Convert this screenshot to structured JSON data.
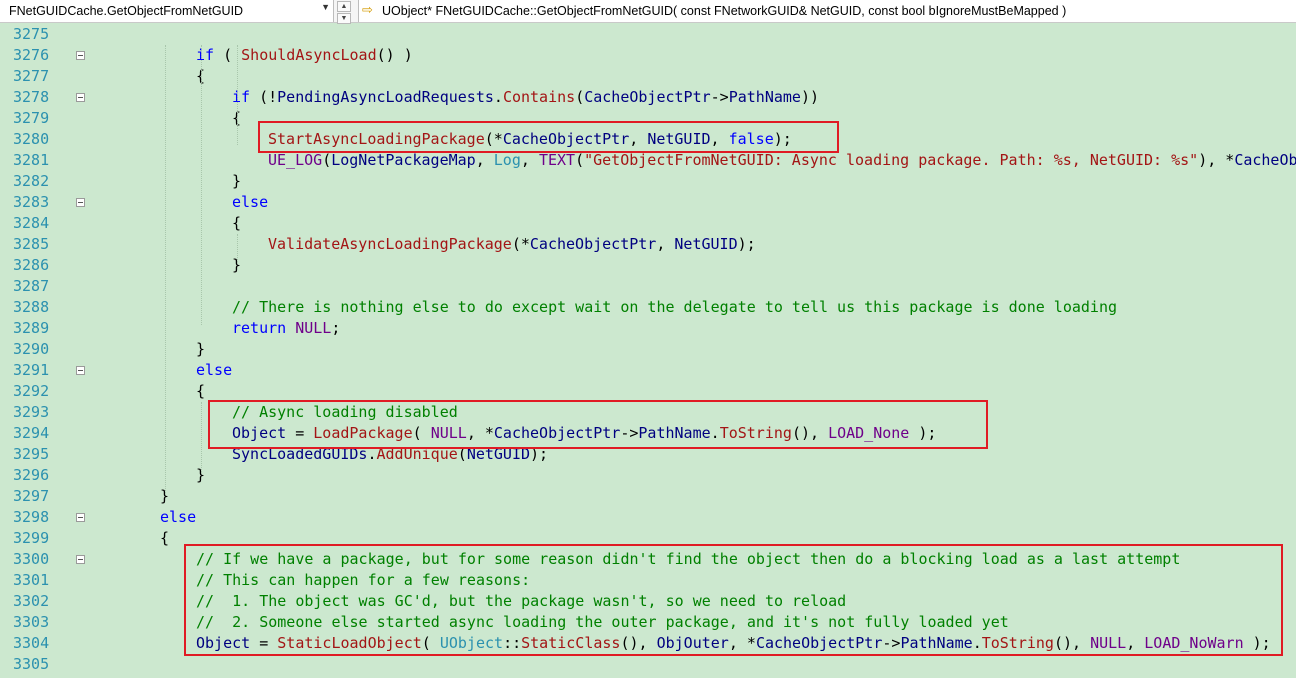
{
  "toolbar": {
    "scope_dropdown": "FNetGUIDCache.GetObjectFromNetGUID",
    "dropdown_arrow": "▼",
    "nav_up": "▲",
    "nav_down": "▼",
    "member_icon": "⇨",
    "member_signature": "UObject* FNetGUIDCache::GetObjectFromNetGUID( const FNetworkGUID& NetGUID, const bool bIgnoreMustBeMapped )"
  },
  "colors": {
    "background": "#cce8cf",
    "line_number": "#2b91af",
    "keyword": "#0000ff",
    "function": "#a31515",
    "type": "#2b91af",
    "comment": "#008000",
    "variable": "#000080",
    "macro": "#6f008a",
    "highlight_box": "#e01b24"
  },
  "lines": [
    {
      "n": "3275",
      "fold": false,
      "indent": 0,
      "tokens": []
    },
    {
      "n": "3276",
      "fold": true,
      "indent": 5,
      "tokens": [
        [
          "k",
          "if"
        ],
        [
          "p",
          " ( "
        ],
        [
          "f",
          "ShouldAsyncLoad"
        ],
        [
          "p",
          "() )"
        ]
      ]
    },
    {
      "n": "3277",
      "fold": false,
      "indent": 5,
      "tokens": [
        [
          "p",
          "{"
        ]
      ]
    },
    {
      "n": "3278",
      "fold": true,
      "indent": 6,
      "tokens": [
        [
          "k",
          "if"
        ],
        [
          "p",
          " (!"
        ],
        [
          "v",
          "PendingAsyncLoadRequests"
        ],
        [
          "p",
          "."
        ],
        [
          "f",
          "Contains"
        ],
        [
          "p",
          "("
        ],
        [
          "v",
          "CacheObjectPtr"
        ],
        [
          "p",
          "->"
        ],
        [
          "v",
          "PathName"
        ],
        [
          "p",
          "))"
        ]
      ]
    },
    {
      "n": "3279",
      "fold": false,
      "indent": 6,
      "tokens": [
        [
          "p",
          "{"
        ]
      ]
    },
    {
      "n": "3280",
      "fold": false,
      "indent": 7,
      "tokens": [
        [
          "f",
          "StartAsyncLoadingPackage"
        ],
        [
          "p",
          "(*"
        ],
        [
          "v",
          "CacheObjectPtr"
        ],
        [
          "p",
          ", "
        ],
        [
          "v",
          "NetGUID"
        ],
        [
          "p",
          ", "
        ],
        [
          "k",
          "false"
        ],
        [
          "p",
          ");"
        ]
      ]
    },
    {
      "n": "3281",
      "fold": false,
      "indent": 7,
      "tokens": [
        [
          "m",
          "UE_LOG"
        ],
        [
          "p",
          "("
        ],
        [
          "v",
          "LogNetPackageMap"
        ],
        [
          "p",
          ", "
        ],
        [
          "t",
          "Log"
        ],
        [
          "p",
          ", "
        ],
        [
          "m",
          "TEXT"
        ],
        [
          "p",
          "("
        ],
        [
          "s",
          "\"GetObjectFromNetGUID: Async loading package. Path: %s, NetGUID: %s\""
        ],
        [
          "p",
          "), *"
        ],
        [
          "v",
          "CacheObj"
        ]
      ]
    },
    {
      "n": "3282",
      "fold": false,
      "indent": 6,
      "tokens": [
        [
          "p",
          "}"
        ]
      ]
    },
    {
      "n": "3283",
      "fold": true,
      "indent": 6,
      "tokens": [
        [
          "k",
          "else"
        ]
      ]
    },
    {
      "n": "3284",
      "fold": false,
      "indent": 6,
      "tokens": [
        [
          "p",
          "{"
        ]
      ]
    },
    {
      "n": "3285",
      "fold": false,
      "indent": 7,
      "tokens": [
        [
          "f",
          "ValidateAsyncLoadingPackage"
        ],
        [
          "p",
          "(*"
        ],
        [
          "v",
          "CacheObjectPtr"
        ],
        [
          "p",
          ", "
        ],
        [
          "v",
          "NetGUID"
        ],
        [
          "p",
          ");"
        ]
      ]
    },
    {
      "n": "3286",
      "fold": false,
      "indent": 6,
      "tokens": [
        [
          "p",
          "}"
        ]
      ]
    },
    {
      "n": "3287",
      "fold": false,
      "indent": 0,
      "tokens": []
    },
    {
      "n": "3288",
      "fold": false,
      "indent": 6,
      "tokens": [
        [
          "c",
          "// There is nothing else to do except wait on the delegate to tell us this package is done loading"
        ]
      ]
    },
    {
      "n": "3289",
      "fold": false,
      "indent": 6,
      "tokens": [
        [
          "k",
          "return"
        ],
        [
          "p",
          " "
        ],
        [
          "m",
          "NULL"
        ],
        [
          "p",
          ";"
        ]
      ]
    },
    {
      "n": "3290",
      "fold": false,
      "indent": 5,
      "tokens": [
        [
          "p",
          "}"
        ]
      ]
    },
    {
      "n": "3291",
      "fold": true,
      "indent": 5,
      "tokens": [
        [
          "k",
          "else"
        ]
      ]
    },
    {
      "n": "3292",
      "fold": false,
      "indent": 5,
      "tokens": [
        [
          "p",
          "{"
        ]
      ]
    },
    {
      "n": "3293",
      "fold": false,
      "indent": 6,
      "tokens": [
        [
          "c",
          "// Async loading disabled"
        ]
      ]
    },
    {
      "n": "3294",
      "fold": false,
      "indent": 6,
      "tokens": [
        [
          "v",
          "Object"
        ],
        [
          "p",
          " = "
        ],
        [
          "f",
          "LoadPackage"
        ],
        [
          "p",
          "( "
        ],
        [
          "m",
          "NULL"
        ],
        [
          "p",
          ", *"
        ],
        [
          "v",
          "CacheObjectPtr"
        ],
        [
          "p",
          "->"
        ],
        [
          "v",
          "PathName"
        ],
        [
          "p",
          "."
        ],
        [
          "f",
          "ToString"
        ],
        [
          "p",
          "(), "
        ],
        [
          "m",
          "LOAD_None"
        ],
        [
          "p",
          " );"
        ]
      ]
    },
    {
      "n": "3295",
      "fold": false,
      "indent": 6,
      "tokens": [
        [
          "v",
          "SyncLoadedGUIDs"
        ],
        [
          "p",
          "."
        ],
        [
          "f",
          "AddUnique"
        ],
        [
          "p",
          "("
        ],
        [
          "v",
          "NetGUID"
        ],
        [
          "p",
          ");"
        ]
      ]
    },
    {
      "n": "3296",
      "fold": false,
      "indent": 5,
      "tokens": [
        [
          "p",
          "}"
        ]
      ]
    },
    {
      "n": "3297",
      "fold": false,
      "indent": 4,
      "tokens": [
        [
          "p",
          "}"
        ]
      ]
    },
    {
      "n": "3298",
      "fold": true,
      "indent": 4,
      "tokens": [
        [
          "k",
          "else"
        ]
      ]
    },
    {
      "n": "3299",
      "fold": false,
      "indent": 4,
      "tokens": [
        [
          "p",
          "{"
        ]
      ]
    },
    {
      "n": "3300",
      "fold": true,
      "indent": 5,
      "tokens": [
        [
          "c",
          "// If we have a package, but for some reason didn't find the object then do a blocking load as a last attempt"
        ]
      ]
    },
    {
      "n": "3301",
      "fold": false,
      "indent": 5,
      "tokens": [
        [
          "c",
          "// This can happen for a few reasons:"
        ]
      ]
    },
    {
      "n": "3302",
      "fold": false,
      "indent": 5,
      "tokens": [
        [
          "c",
          "//  1. The object was GC'd, but the package wasn't, so we need to reload"
        ]
      ]
    },
    {
      "n": "3303",
      "fold": false,
      "indent": 5,
      "tokens": [
        [
          "c",
          "//  2. Someone else started async loading the outer package, and it's not fully loaded yet"
        ]
      ]
    },
    {
      "n": "3304",
      "fold": false,
      "indent": 5,
      "tokens": [
        [
          "v",
          "Object"
        ],
        [
          "p",
          " = "
        ],
        [
          "f",
          "StaticLoadObject"
        ],
        [
          "p",
          "( "
        ],
        [
          "t",
          "UObject"
        ],
        [
          "p",
          "::"
        ],
        [
          "f",
          "StaticClass"
        ],
        [
          "p",
          "(), "
        ],
        [
          "v",
          "ObjOuter"
        ],
        [
          "p",
          ", *"
        ],
        [
          "v",
          "CacheObjectPtr"
        ],
        [
          "p",
          "->"
        ],
        [
          "v",
          "PathName"
        ],
        [
          "p",
          "."
        ],
        [
          "f",
          "ToString"
        ],
        [
          "p",
          "(), "
        ],
        [
          "m",
          "NULL"
        ],
        [
          "p",
          ", "
        ],
        [
          "m",
          "LOAD_NoWarn"
        ],
        [
          "p",
          " );"
        ]
      ]
    },
    {
      "n": "3305",
      "fold": false,
      "indent": 0,
      "tokens": []
    }
  ]
}
